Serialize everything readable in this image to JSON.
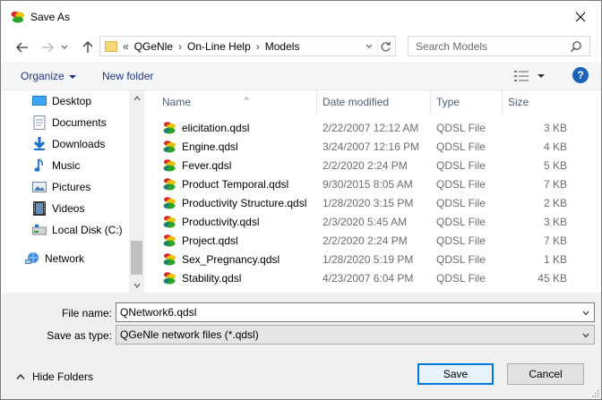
{
  "window": {
    "title": "Save As"
  },
  "nav": {
    "path": [
      "QGeNle",
      "On-Line Help",
      "Models"
    ],
    "overflow_glyph": "«",
    "search_placeholder": "Search Models"
  },
  "toolbar": {
    "organize_label": "Organize",
    "new_folder_label": "New folder",
    "help_label": "?"
  },
  "sidebar": {
    "items": [
      {
        "label": "Desktop",
        "icon": "desktop-icon"
      },
      {
        "label": "Documents",
        "icon": "documents-icon"
      },
      {
        "label": "Downloads",
        "icon": "downloads-icon"
      },
      {
        "label": "Music",
        "icon": "music-icon"
      },
      {
        "label": "Pictures",
        "icon": "pictures-icon"
      },
      {
        "label": "Videos",
        "icon": "videos-icon"
      },
      {
        "label": "Local Disk (C:)",
        "icon": "disk-icon"
      },
      {
        "label": "Network",
        "icon": "network-icon"
      }
    ]
  },
  "files": {
    "columns": {
      "name": "Name",
      "date": "Date modified",
      "type": "Type",
      "size": "Size"
    },
    "rows": [
      {
        "name": "elicitation.qdsl",
        "date": "2/22/2007 12:12 AM",
        "type": "QDSL File",
        "size": "3 KB"
      },
      {
        "name": "Engine.qdsl",
        "date": "3/24/2007 12:16 PM",
        "type": "QDSL File",
        "size": "4 KB"
      },
      {
        "name": "Fever.qdsl",
        "date": "2/2/2020 2:24 PM",
        "type": "QDSL File",
        "size": "5 KB"
      },
      {
        "name": "Product Temporal.qdsl",
        "date": "9/30/2015 8:05 AM",
        "type": "QDSL File",
        "size": "7 KB"
      },
      {
        "name": "Productivity Structure.qdsl",
        "date": "1/28/2020 3:15 PM",
        "type": "QDSL File",
        "size": "2 KB"
      },
      {
        "name": "Productivity.qdsl",
        "date": "2/3/2020 5:45 AM",
        "type": "QDSL File",
        "size": "3 KB"
      },
      {
        "name": "Project.qdsl",
        "date": "2/2/2020 2:24 PM",
        "type": "QDSL File",
        "size": "7 KB"
      },
      {
        "name": "Sex_Pregnancy.qdsl",
        "date": "1/28/2020 5:19 PM",
        "type": "QDSL File",
        "size": "1 KB"
      },
      {
        "name": "Stability.qdsl",
        "date": "4/23/2007 6:04 PM",
        "type": "QDSL File",
        "size": "45 KB"
      }
    ]
  },
  "form": {
    "file_name_label": "File name:",
    "file_name_value": "QNetwork6.qdsl",
    "save_type_label": "Save as type:",
    "save_type_value": "QGeNle network files (*.qdsl)"
  },
  "footer": {
    "hide_folders_label": "Hide Folders",
    "save_label": "Save",
    "cancel_label": "Cancel"
  },
  "colors": {
    "link": "#1e3287",
    "accent": "#0078d7",
    "help": "#1c62b9"
  }
}
